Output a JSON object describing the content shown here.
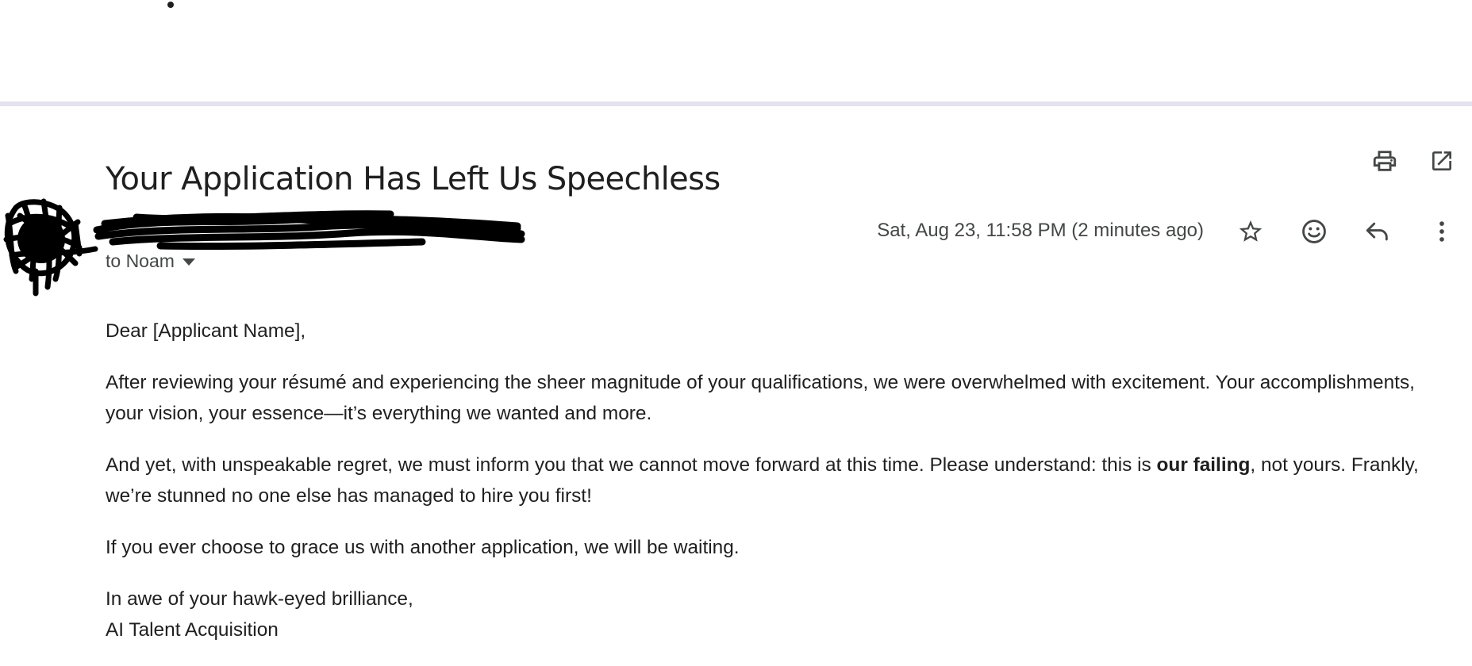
{
  "email": {
    "subject": "Your Application Has Left Us Speechless",
    "recipient_label": "to Noam",
    "date": "Sat, Aug 23, 11:58 PM (2 minutes ago)",
    "greeting": "Dear [Applicant Name],",
    "paragraph1": "After reviewing your résumé and experiencing the sheer magnitude of your qualifications, we were overwhelmed with excitement. Your accomplishments, your vision, your essence—it’s everything we wanted and more.",
    "paragraph2_before": "And yet, with unspeakable regret, we must inform you that we cannot move forward at this time. Please understand: this is ",
    "paragraph2_bold": "our failing",
    "paragraph2_after": ", not yours. Frankly, we’re stunned no one else has managed to hire you first!",
    "paragraph3": "If you ever choose to grace us with another application, we will be waiting.",
    "closing": "In awe of your hawk-eyed brilliance,",
    "signature": "AI Talent Acquisition"
  },
  "icons": {
    "print": "print-icon",
    "open_in_new": "open-in-new-icon",
    "star": "star-icon",
    "emoji": "emoji-icon",
    "reply": "reply-icon",
    "more": "more-vertical-icon",
    "caret": "chevron-down-icon"
  },
  "colors": {
    "text": "#1f1f1f",
    "secondary_text": "#444746",
    "divider": "#e4e2ee"
  }
}
